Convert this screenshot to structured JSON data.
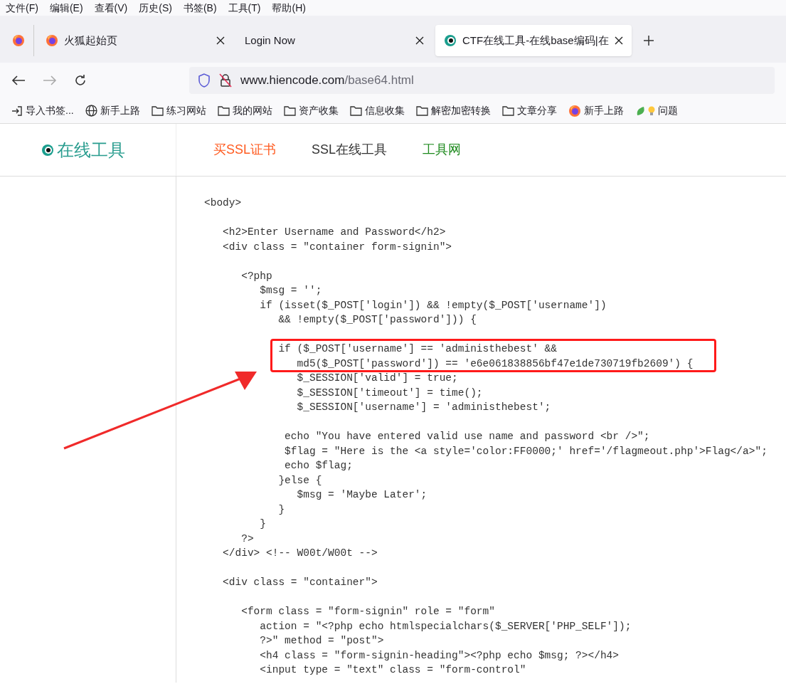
{
  "menu": [
    "文件(F)",
    "编辑(E)",
    "查看(V)",
    "历史(S)",
    "书签(B)",
    "工具(T)",
    "帮助(H)"
  ],
  "tabs": [
    {
      "kind": "pinned-firefox",
      "selected": false
    },
    {
      "kind": "firefox",
      "title": "火狐起始页",
      "selected": false
    },
    {
      "kind": "plain",
      "title": "Login Now",
      "selected": false
    },
    {
      "kind": "site",
      "title": "CTF在线工具-在线base编码|在",
      "selected": true
    }
  ],
  "url": {
    "host": "www.hiencode.com",
    "path": "/base64.html"
  },
  "bookmarks": [
    {
      "kind": "import",
      "label": "导入书签..."
    },
    {
      "kind": "globe",
      "label": "新手上路"
    },
    {
      "kind": "folder",
      "label": "练习网站"
    },
    {
      "kind": "folder",
      "label": "我的网站"
    },
    {
      "kind": "folder",
      "label": "资产收集"
    },
    {
      "kind": "folder",
      "label": "信息收集"
    },
    {
      "kind": "folder",
      "label": "解密加密转换"
    },
    {
      "kind": "folder",
      "label": "文章分享"
    },
    {
      "kind": "firefox",
      "label": "新手上路"
    },
    {
      "kind": "leaf",
      "label": "问题"
    }
  ],
  "site": {
    "logo": "在线工具",
    "nav": [
      {
        "label": "买SSL证书",
        "color": "#ff5a1f"
      },
      {
        "label": "SSL在线工具",
        "color": "#333333"
      },
      {
        "label": "工具网",
        "color": "#1e8a1e"
      }
    ]
  },
  "code_blocks": [
    [
      "<body>"
    ],
    [
      "   <h2>Enter Username and Password</h2>",
      "   <div class = \"container form-signin\">"
    ],
    [
      "      <?php",
      "         $msg = '';",
      "         if (isset($_POST['login']) && !empty($_POST['username'])",
      "            && !empty($_POST['password'])) {"
    ],
    [
      "            if ($_POST['username'] == 'administhebest' &&",
      "               md5($_POST['password']) == 'e6e061838856bf47e1de730719fb2609') {",
      "               $_SESSION['valid'] = true;",
      "               $_SESSION['timeout'] = time();",
      "               $_SESSION['username'] = 'administhebest';"
    ],
    [
      "             echo \"You have entered valid use name and password <br />\";",
      "             $flag = \"Here is the <a style='color:FF0000;' href='/flagmeout.php'>Flag</a>\";",
      "             echo $flag;",
      "            }else {",
      "               $msg = 'Maybe Later';",
      "            }",
      "         }",
      "      ?>",
      "   </div> <!-- W00t/W00t -->"
    ],
    [
      "   <div class = \"container\">"
    ],
    [
      "      <form class = \"form-signin\" role = \"form\"",
      "         action = \"<?php echo htmlspecialchars($_SERVER['PHP_SELF']);",
      "         ?>\" method = \"post\">",
      "         <h4 class = \"form-signin-heading\"><?php echo $msg; ?></h4>",
      "         <input type = \"text\" class = \"form-control\""
    ]
  ]
}
